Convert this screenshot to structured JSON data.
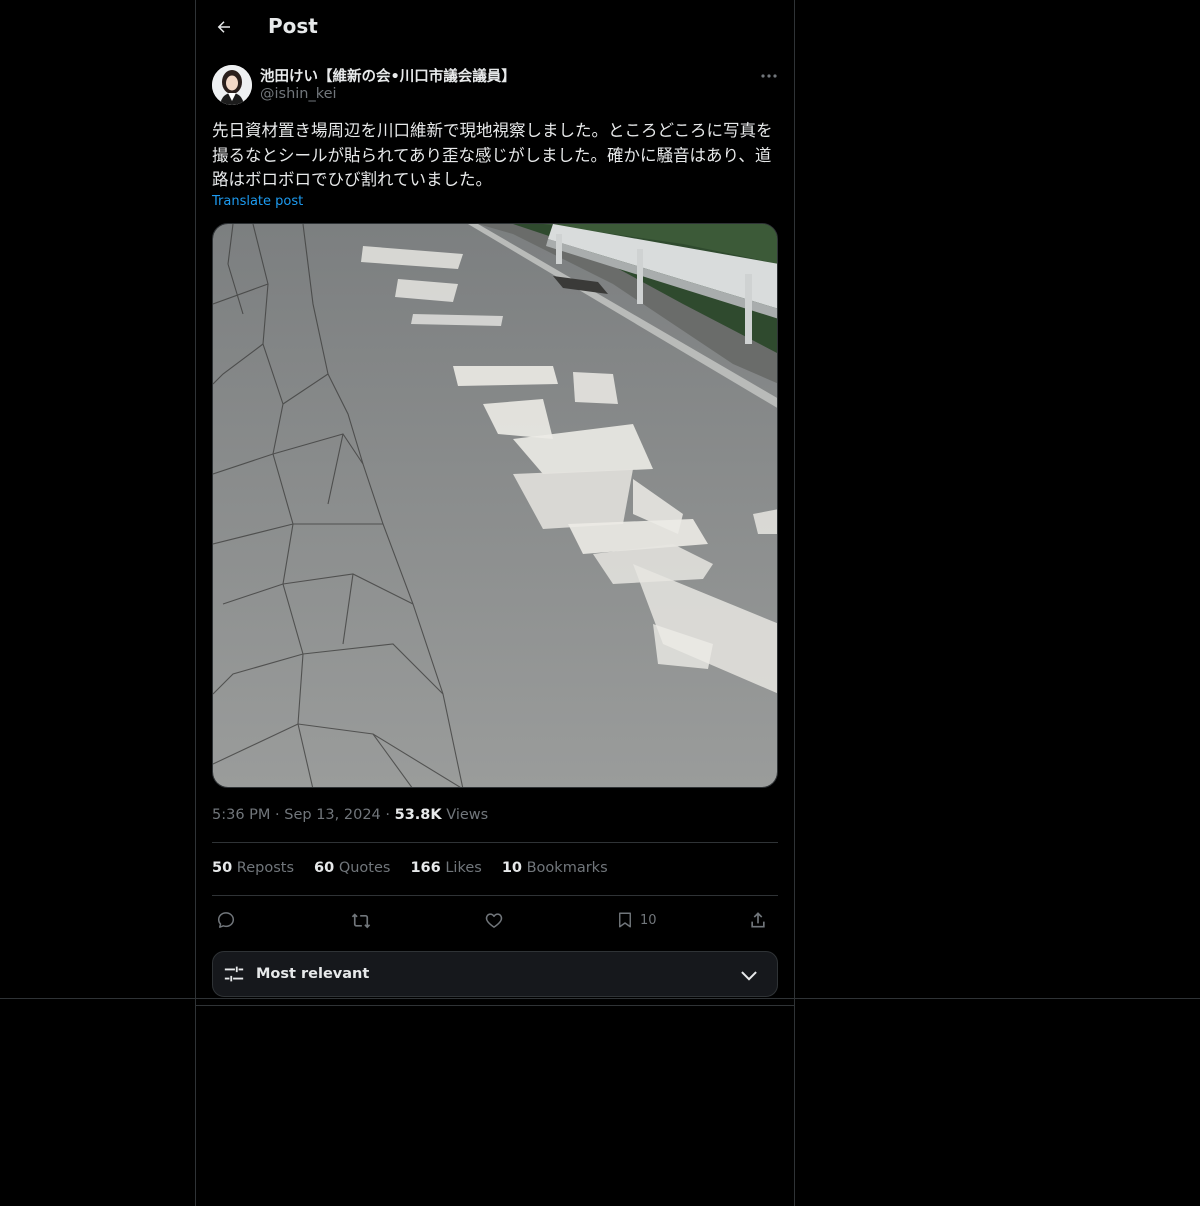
{
  "header": {
    "title": "Post"
  },
  "author": {
    "display_name": "池田けい【維新の会•川口市議会議員】",
    "handle": "@ishin_kei"
  },
  "post": {
    "text": "先日資材置き場周辺を川口維新で現地視察しました。ところどころに写真を撮るなとシールが貼られてあり歪な感じがしました。確かに騒音はあり、道路はボロボロでひび割れていました。",
    "translate_label": "Translate post",
    "time": "5:36 PM",
    "date": "Sep 13, 2024",
    "separator": "·",
    "views_count": "53.8K",
    "views_label": "Views"
  },
  "stats": {
    "reposts_count": "50",
    "reposts_label": "Reposts",
    "quotes_count": "60",
    "quotes_label": "Quotes",
    "likes_count": "166",
    "likes_label": "Likes",
    "bookmarks_count": "10",
    "bookmarks_label": "Bookmarks"
  },
  "actions": {
    "reply_icon": "reply-icon",
    "repost_icon": "repost-icon",
    "like_icon": "heart-icon",
    "bookmark_icon": "bookmark-icon",
    "bookmark_count": "10",
    "share_icon": "share-icon"
  },
  "replies_sort": {
    "label": "Most relevant",
    "icon": "sliders-icon"
  },
  "colors": {
    "background": "#000000",
    "text": "#e7e9ea",
    "muted": "#71767b",
    "link": "#1d9bf0",
    "border": "#2f3336"
  }
}
